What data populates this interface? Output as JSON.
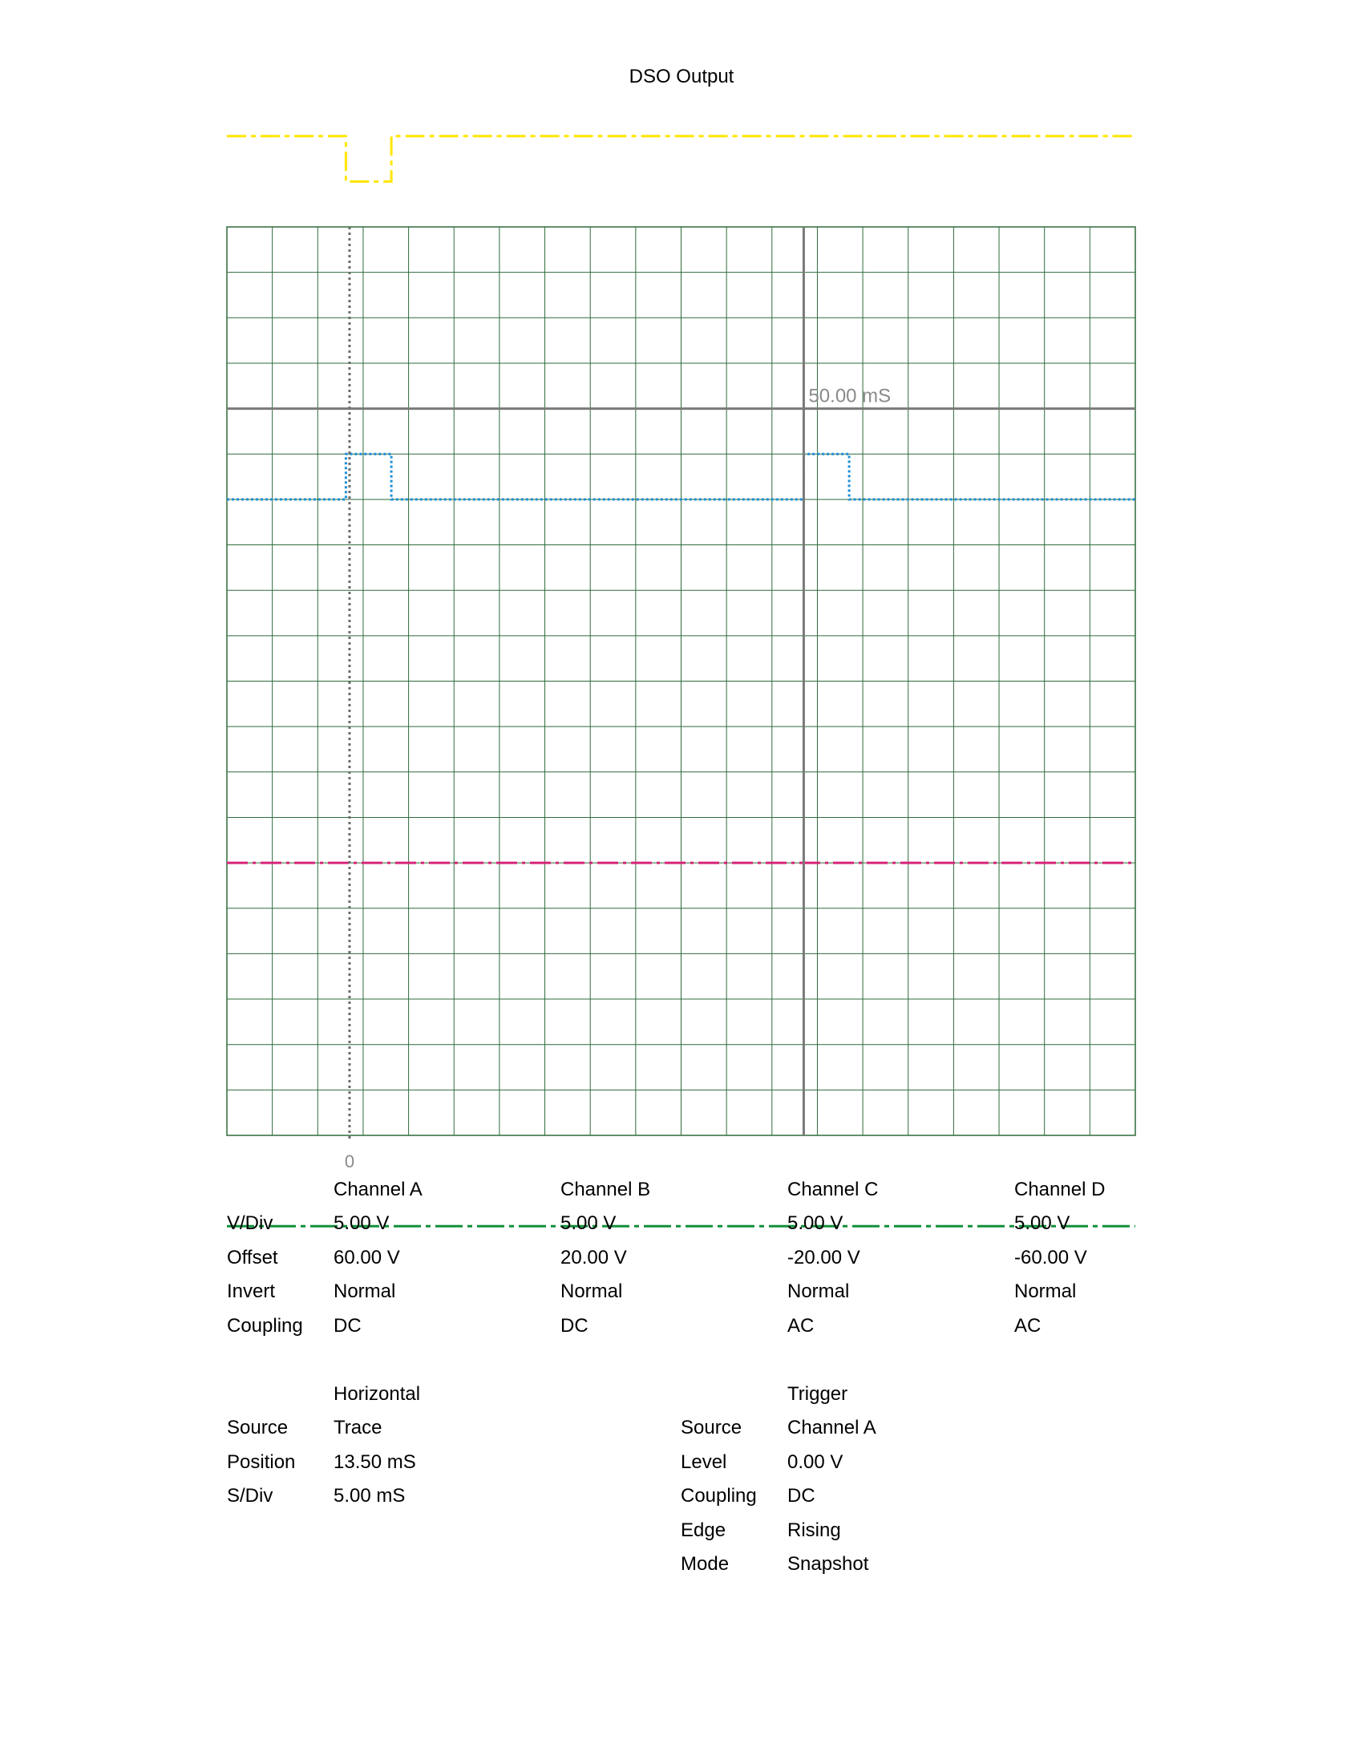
{
  "page_title": "DSO Output",
  "chart_data": {
    "type": "line",
    "title": "DSO Output",
    "grid": true,
    "divisions": {
      "x": 20,
      "y": 20
    },
    "x_axis": {
      "unit": "mS",
      "s_per_div": 5.0,
      "ticks": [
        {
          "value": 0,
          "label": "0"
        }
      ]
    },
    "cursor": {
      "time": 50.0,
      "label": "50.00 mS"
    },
    "series": [
      {
        "name": "Channel A",
        "color": "#ffe600",
        "style": "dashed-light",
        "points": [
          [
            -13.5,
            60
          ],
          [
            -0.4,
            60
          ],
          [
            -0.4,
            55
          ],
          [
            4.6,
            55
          ],
          [
            4.6,
            60
          ],
          [
            51,
            60
          ],
          [
            51,
            60
          ],
          [
            86.5,
            60
          ]
        ]
      },
      {
        "name": "Channel B",
        "color": "#1f8fd6",
        "style": "dotted",
        "points": [
          [
            -13.5,
            20
          ],
          [
            -0.4,
            20
          ],
          [
            -0.4,
            25
          ],
          [
            4.6,
            25
          ],
          [
            4.6,
            20
          ],
          [
            50,
            20
          ],
          [
            50,
            25
          ],
          [
            55,
            25
          ],
          [
            55,
            20
          ],
          [
            86.5,
            20
          ]
        ]
      },
      {
        "name": "Channel C",
        "color": "#d6247a",
        "style": "dash",
        "points": [
          [
            -13.5,
            -20
          ],
          [
            86.5,
            -20
          ]
        ]
      },
      {
        "name": "Channel D",
        "color": "#12903a",
        "style": "dash-long",
        "points": [
          [
            -13.5,
            -60
          ],
          [
            86.5,
            -60
          ]
        ]
      }
    ]
  },
  "channels": {
    "row_labels": {
      "vdiv": "V/Div",
      "offset": "Offset",
      "invert": "Invert",
      "coupling": "Coupling"
    },
    "list": [
      {
        "name": "Channel A",
        "vdiv": "5.00 V",
        "offset": "60.00 V",
        "invert": "Normal",
        "coupling": "DC"
      },
      {
        "name": "Channel B",
        "vdiv": "5.00 V",
        "offset": "20.00 V",
        "invert": "Normal",
        "coupling": "DC"
      },
      {
        "name": "Channel C",
        "vdiv": "5.00 V",
        "offset": "-20.00 V",
        "invert": "Normal",
        "coupling": "AC"
      },
      {
        "name": "Channel D",
        "vdiv": "5.00 V",
        "offset": "-60.00 V",
        "invert": "Normal",
        "coupling": "AC"
      }
    ]
  },
  "horizontal": {
    "heading": "Horizontal",
    "rows": [
      {
        "label": "Source",
        "value": "Trace"
      },
      {
        "label": "Position",
        "value": "13.50 mS"
      },
      {
        "label": "S/Div",
        "value": "5.00 mS"
      }
    ]
  },
  "trigger": {
    "heading": "Trigger",
    "rows": [
      {
        "label": "Source",
        "value": "Channel A"
      },
      {
        "label": "Level",
        "value": "0.00 V"
      },
      {
        "label": "Coupling",
        "value": "DC"
      },
      {
        "label": "Edge",
        "value": "Rising"
      },
      {
        "label": "Mode",
        "value": "Snapshot"
      }
    ]
  }
}
